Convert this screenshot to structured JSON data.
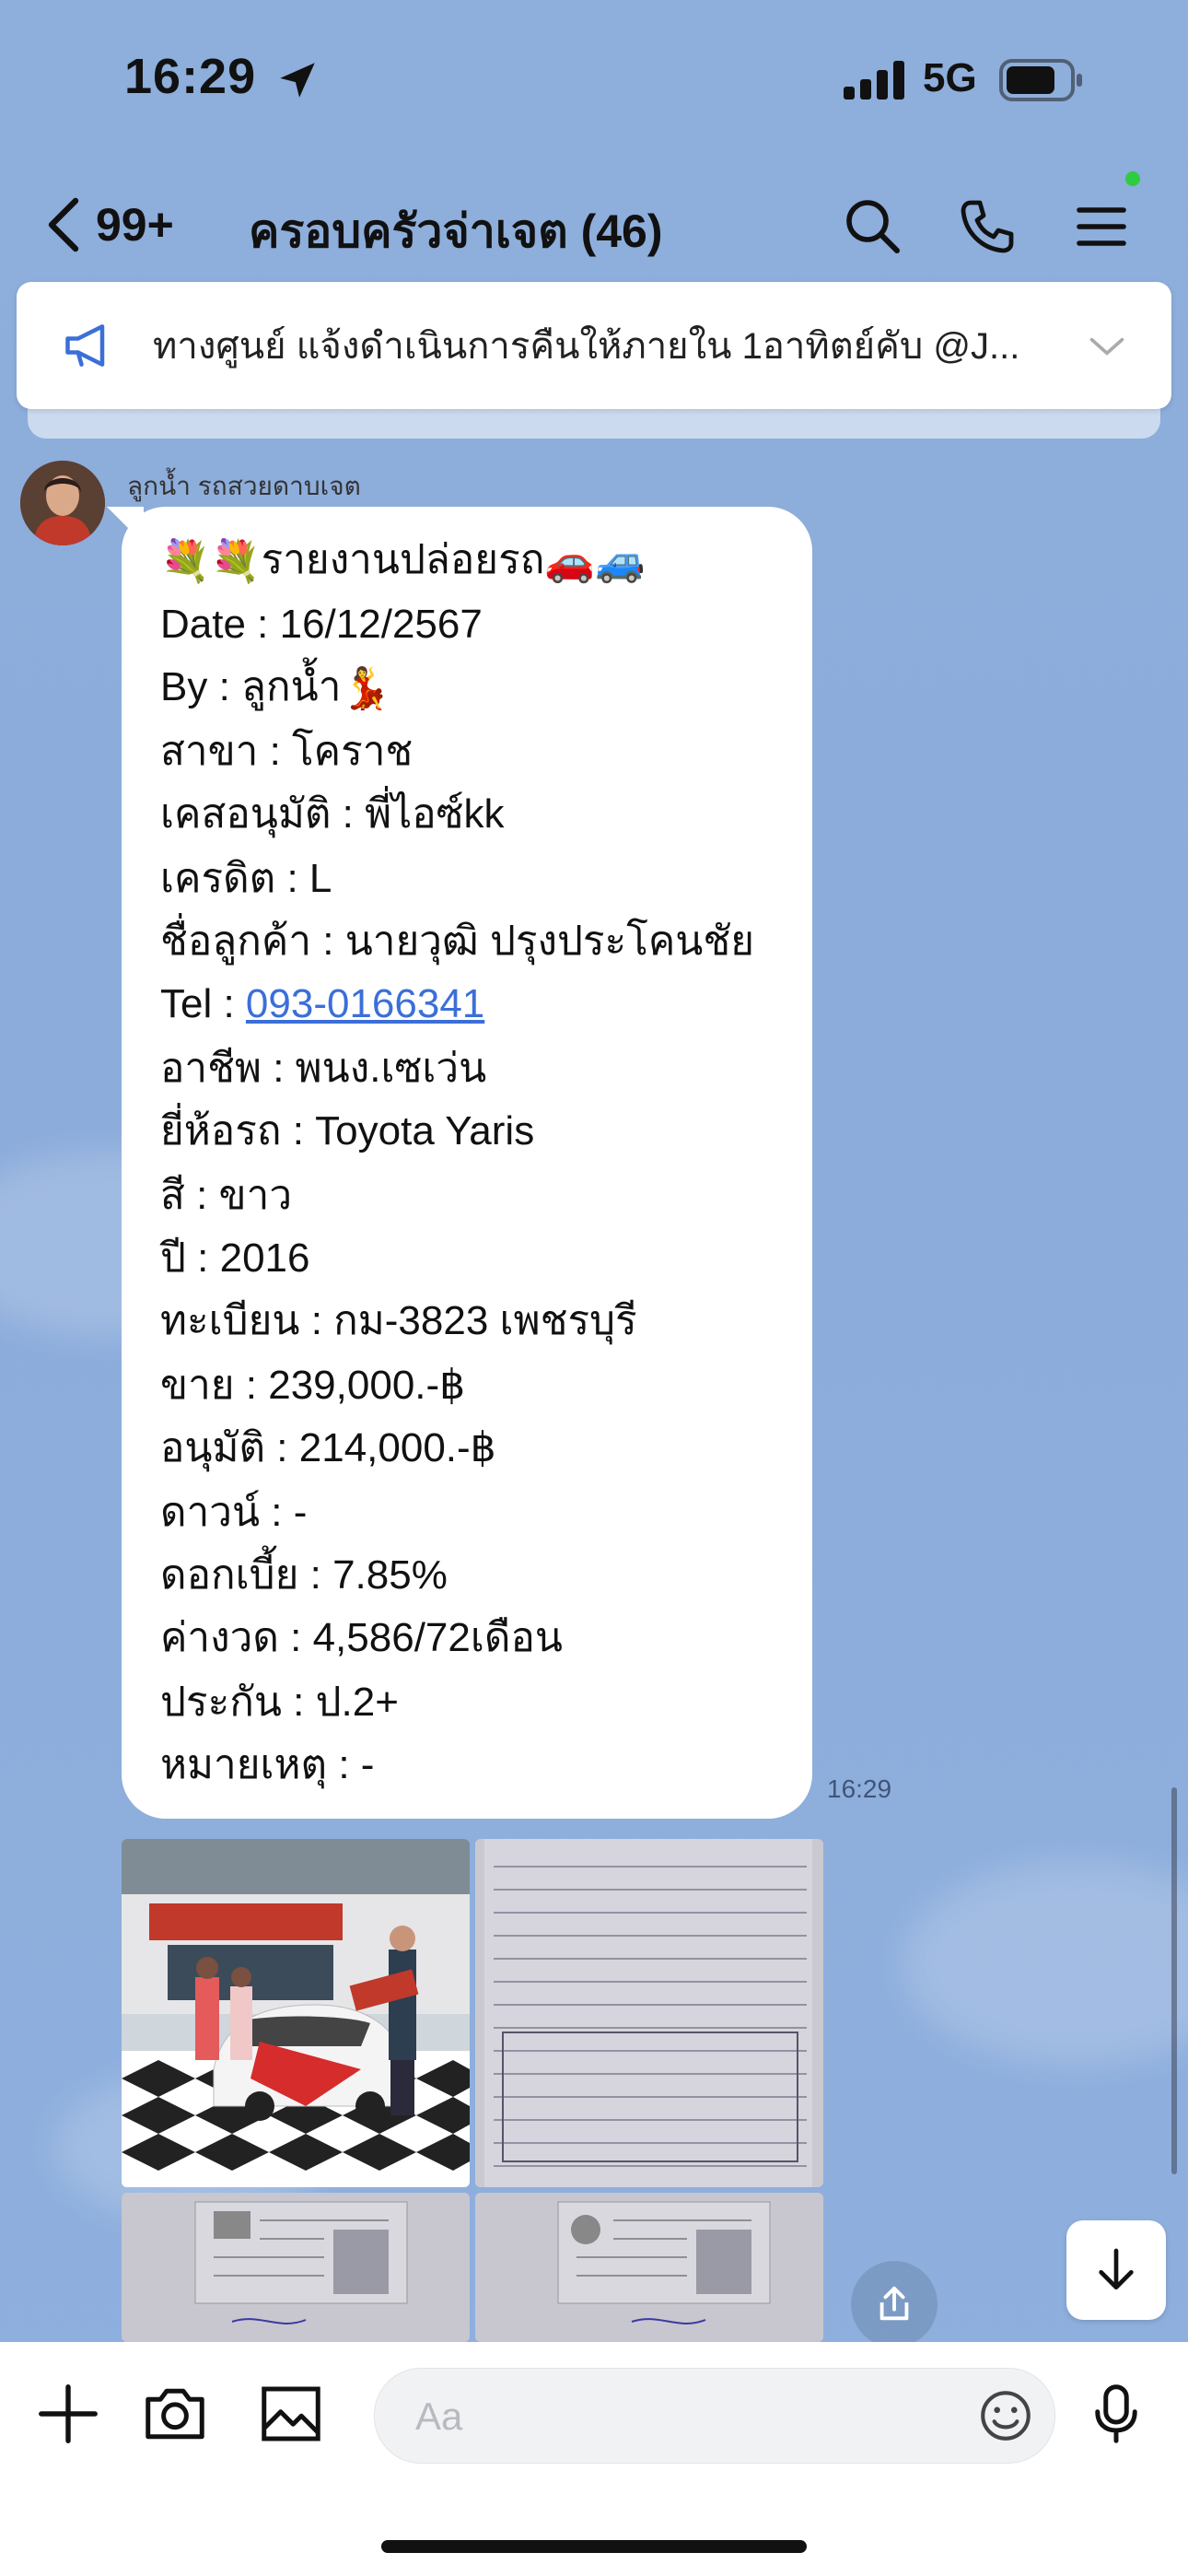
{
  "status_bar": {
    "time": "16:29",
    "network": "5G"
  },
  "header": {
    "unread_count": "99+",
    "title": "ครอบครัวจ่าเจต (46)",
    "icons": [
      "back-icon",
      "search-icon",
      "phone-icon",
      "menu-icon"
    ]
  },
  "announcement": {
    "text": "ทางศูนย์ แจ้งดำเนินการคืนให้ภายใน 1อาทิตย์คับ @J..."
  },
  "message": {
    "sender": "ลูกน้ำ รถสวยดาบเจต",
    "time": "16:29",
    "title_emoji_left": "💐💐",
    "title": "รายงานปล่อยรถ",
    "title_emoji_right": "🚗🚙",
    "lines": {
      "date": "Date : 16/12/2567",
      "by": "By : ลูกน้ำ",
      "by_emoji": "💃",
      "branch": "สาขา : โคราช",
      "approver": "เคสอนุมัติ : พี่ไอซ์kk",
      "credit": "เครดิต : L",
      "customer": "ชื่อลูกค้า : นายวุฒิ ปรุงประโคนชัย",
      "tel_label": "Tel : ",
      "tel_number": "093-0166341",
      "job": "อาชีพ : พนง.เซเว่น",
      "brand": "ยี่ห้อรถ : Toyota Yaris",
      "color": "สี : ขาว",
      "year": "ปี : 2016",
      "plate": "ทะเบียน : กม-3823 เพชรบุรี",
      "sell": "ขาย : 239,000.-฿",
      "approved": "อนุมัติ : 214,000.-฿",
      "down": "ดาวน์ : -",
      "interest": "ดอกเบี้ย : 7.85%",
      "installment": "ค่างวด : 4,586/72เดือน",
      "insurance": "ประกัน : ป.2+",
      "note": "หมายเหตุ : -"
    }
  },
  "input_bar": {
    "placeholder": "Aa"
  },
  "colors": {
    "background": "#8eaedb",
    "link": "#3b6fd8",
    "online_dot": "#2ecc40"
  }
}
